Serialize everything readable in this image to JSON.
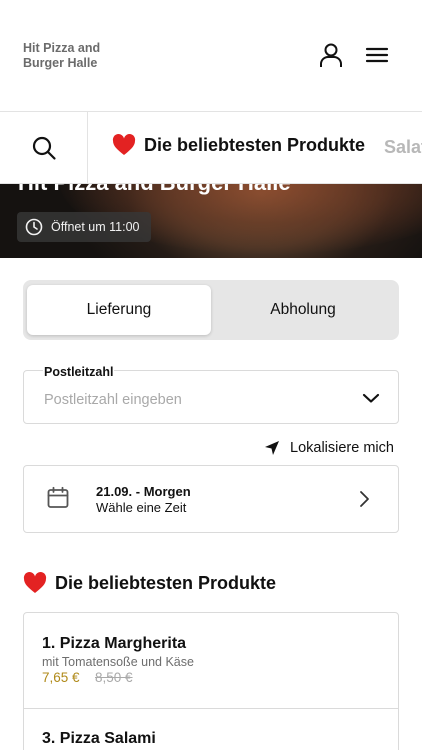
{
  "header": {
    "brand": "Hit Pizza and Burger Halle",
    "icons": [
      "user-icon",
      "menu-icon"
    ]
  },
  "category_nav": {
    "active": "Die beliebtesten Produkte",
    "next": "Salat"
  },
  "hero": {
    "title": "Hit Pizza and Burger Halle",
    "hours": "Öffnet um 11:00"
  },
  "order_mode": {
    "options": [
      "Lieferung",
      "Abholung"
    ],
    "selected": "Lieferung"
  },
  "postal": {
    "label": "Postleitzahl",
    "placeholder": "Postleitzahl eingeben",
    "value": ""
  },
  "locate": {
    "label": "Lokalisiere mich"
  },
  "delivery_time": {
    "date": "21.09. - Morgen",
    "hint": "Wähle eine Zeit"
  },
  "section": {
    "title": "Die beliebtesten Produkte"
  },
  "products": [
    {
      "name": "1. Pizza Margherita",
      "description": "mit Tomatensoße und Käse",
      "price": "7,65 €",
      "old_price": "8,50 €"
    },
    {
      "name": "3. Pizza Salami"
    }
  ],
  "colors": {
    "price": "#b08a1a",
    "heart": "#e32222",
    "toggle_bg": "#e6e6e6"
  }
}
